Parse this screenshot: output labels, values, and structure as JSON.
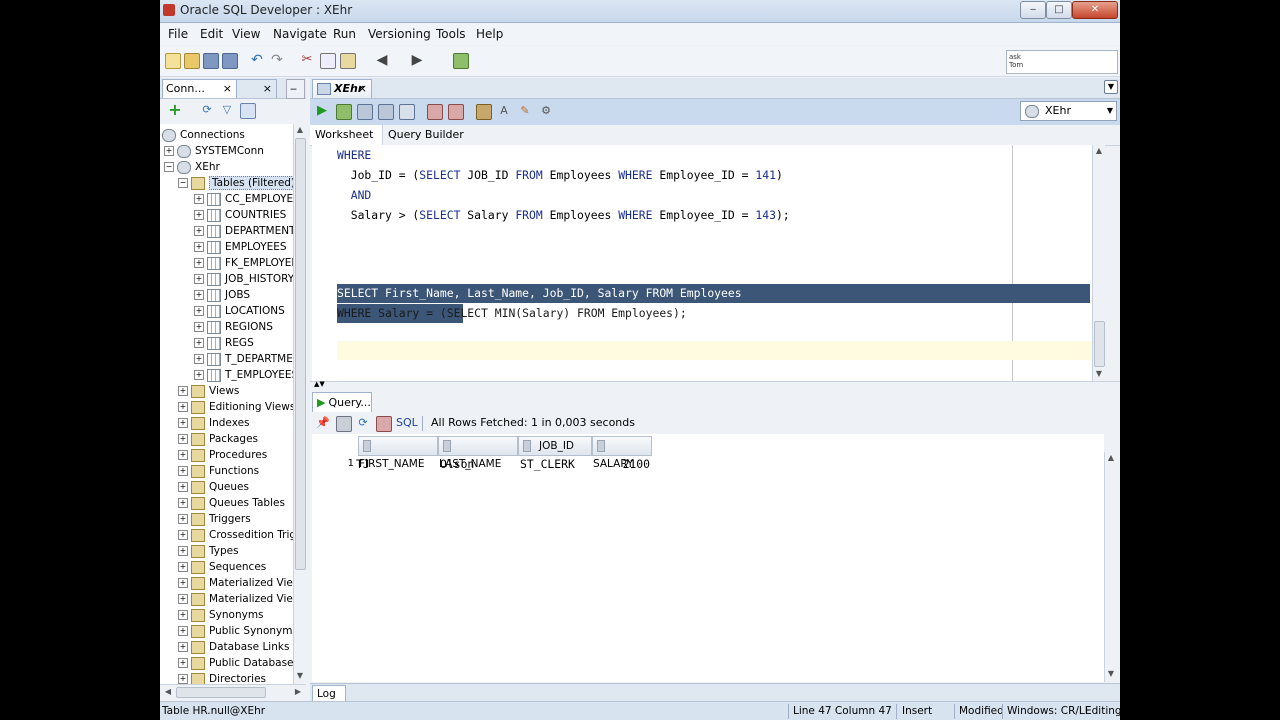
{
  "window": {
    "title": "Oracle SQL Developer : XEhr"
  },
  "menu": [
    "File",
    "Edit",
    "View",
    "Navigate",
    "Run",
    "Versioning",
    "Tools",
    "Help"
  ],
  "search": {
    "hint_line1": "ask",
    "hint_line2": "Tom"
  },
  "left_panel": {
    "tab_connections": "Conn...",
    "tree_root": "Connections",
    "connections": [
      "SYSTEMConn",
      "XEhr"
    ],
    "tables_node": "Tables (Filtered)",
    "tables": [
      "CC_EMPLOYEES",
      "COUNTRIES",
      "DEPARTMENTS",
      "EMPLOYEES",
      "FK_EMPLOYEES",
      "JOB_HISTORY",
      "JOBS",
      "LOCATIONS",
      "REGIONS",
      "REGS",
      "T_DEPARTMENTS",
      "T_EMPLOYEES"
    ],
    "nodes": [
      "Views",
      "Editioning Views",
      "Indexes",
      "Packages",
      "Procedures",
      "Functions",
      "Queues",
      "Queues Tables",
      "Triggers",
      "Crossedition Triggers",
      "Types",
      "Sequences",
      "Materialized Views",
      "Materialized Views",
      "Synonyms",
      "Public Synonyms",
      "Database Links",
      "Public Database Links",
      "Directories"
    ]
  },
  "editor": {
    "tab_label": "XEhr",
    "connection": "XEhr",
    "subtabs": {
      "worksheet": "Worksheet",
      "query_builder": "Query Builder"
    },
    "lines": {
      "l1": "WHERE",
      "l2a": "  Job_ID = (",
      "l2b": "SELECT",
      "l2c": " JOB_ID ",
      "l2d": "FROM",
      "l2e": " Employees ",
      "l2f": "WHERE",
      "l2g": " Employee_ID = ",
      "l2h": "141",
      "l2i": ")",
      "l3": "  AND",
      "l4a": "  Salary > (",
      "l4b": "SELECT",
      "l4c": " Salary ",
      "l4d": "FROM",
      "l4e": " Employees ",
      "l4f": "WHERE",
      "l4g": " Employee_ID = ",
      "l4h": "143",
      "l4i": ");",
      "l5": "SELECT First_Name, Last_Name, Job_ID, Salary FROM Employees",
      "l6": "WHERE Salary = (SELECT MIN(Salary) FROM Employees);"
    }
  },
  "results": {
    "tab_label": "Query...",
    "sql_label": "SQL",
    "fetched": "All Rows Fetched: 1 in 0,003 seconds",
    "columns": [
      "FIRST_NAME",
      "LAST_NAME",
      "JOB_ID",
      "SALARY"
    ],
    "rows": [
      {
        "num": "1",
        "first_name": "TJ",
        "last_name": "Olson",
        "job_id": "ST_CLERK",
        "salary": "2100"
      }
    ]
  },
  "log": {
    "tab_label": "Log"
  },
  "status": {
    "left": "Table HR.null@XEhr",
    "position": "Line 47 Column 47",
    "mode": "Insert",
    "modified": "Modified",
    "eol": "Windows: CR/LF",
    "editing": "Editing"
  },
  "colors": {
    "selection": "#3c5678",
    "keyword": "#1a2e8c",
    "current_line": "#fffbe0"
  }
}
